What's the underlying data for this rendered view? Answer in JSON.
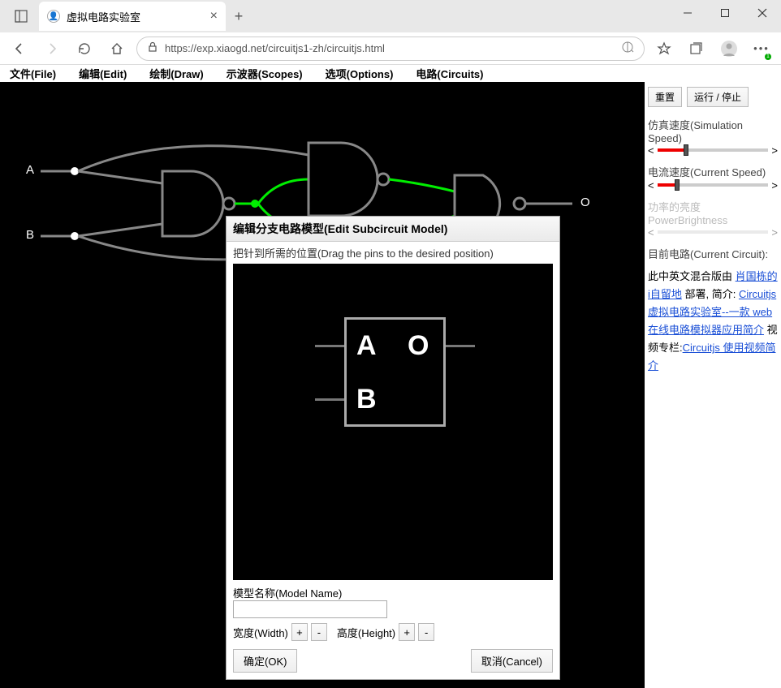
{
  "browser": {
    "tab_title": "虚拟电路实验室",
    "url": "https://exp.xiaogd.net/circuitjs1-zh/circuitjs.html"
  },
  "menubar": {
    "file": "文件(File)",
    "edit": "编辑(Edit)",
    "draw": "绘制(Draw)",
    "scopes": "示波器(Scopes)",
    "options": "选项(Options)",
    "circuits": "电路(Circuits)"
  },
  "right_panel": {
    "reset": "重置",
    "run_stop": "运行 / 停止",
    "sim_speed_label": "仿真速度(Simulation Speed)",
    "current_speed_label": "电流速度(Current Speed)",
    "power_brightness_label": "功率的亮度PowerBrightness",
    "current_circuit_label": "目前电路(Current Circuit):",
    "desc_prefix": "此中英文混合版由 ",
    "link1": "肖国栋的i自留地",
    "deploy": " 部署, 简介: ",
    "link2": "Circuitjs 虚拟电路实验室--一款 web 在线电路模拟器应用简介",
    "video_col": " 视频专栏:",
    "link3": "Circuitjs 使用视频简介"
  },
  "dialog": {
    "title": "编辑分支电路模型(Edit Subcircuit Model)",
    "hint": "把针到所需的位置(Drag the pins to the desired position)",
    "pin_a": "A",
    "pin_b": "B",
    "pin_o": "O",
    "model_name_label": "模型名称(Model Name)",
    "model_name_value": "",
    "width_label": "宽度(Width)",
    "height_label": "高度(Height)",
    "plus": "+",
    "minus": "-",
    "ok": "确定(OK)",
    "cancel": "取消(Cancel)"
  },
  "canvas": {
    "label_a": "A",
    "label_b": "B",
    "label_o": "O"
  }
}
